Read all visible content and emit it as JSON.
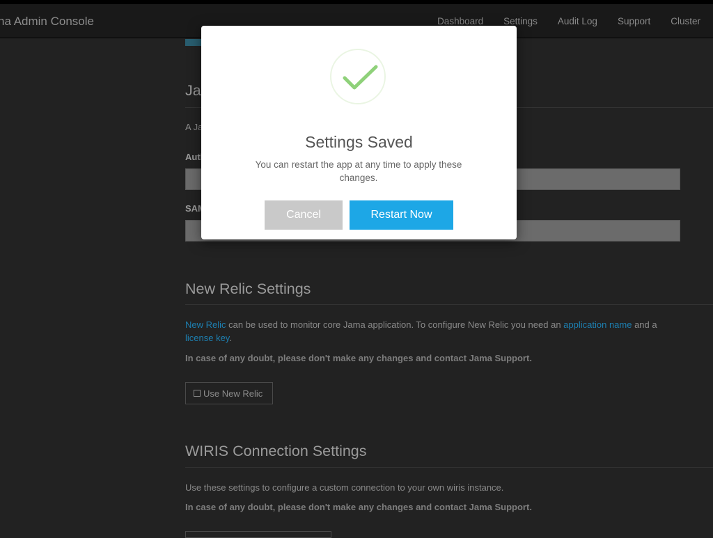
{
  "navbar": {
    "brand": "na Admin Console",
    "links": [
      "Dashboard",
      "Settings",
      "Audit Log",
      "Support",
      "Cluster"
    ]
  },
  "sso_section": {
    "title_partial": "Ja",
    "desc_partial": "A Ja",
    "auth_label_partial": "Auth",
    "saml_label_partial": "SAM"
  },
  "new_relic": {
    "title": "New Relic Settings",
    "desc_link1": "New Relic",
    "desc_text1": " can be used to monitor core Jama application. To configure New Relic you need an ",
    "desc_link2": "application name",
    "desc_text2": " and a",
    "desc_link3": "license key",
    "desc_text3": ".",
    "warning": "In case of any doubt, please don't make any changes and contact Jama Support.",
    "checkbox_label": "Use New Relic"
  },
  "wiris": {
    "title": "WIRIS Connection Settings",
    "desc": "Use these settings to configure a custom connection to your own wiris instance.",
    "warning": "In case of any doubt, please don't make any changes and contact Jama Support."
  },
  "modal": {
    "title": "Settings Saved",
    "message": "You can restart the app at any time to apply these changes.",
    "cancel_label": "Cancel",
    "restart_label": "Restart Now",
    "icon": "check-icon",
    "colors": {
      "check": "#8fd17a",
      "primary": "#1da7e6",
      "cancel": "#c9c9c9"
    }
  }
}
